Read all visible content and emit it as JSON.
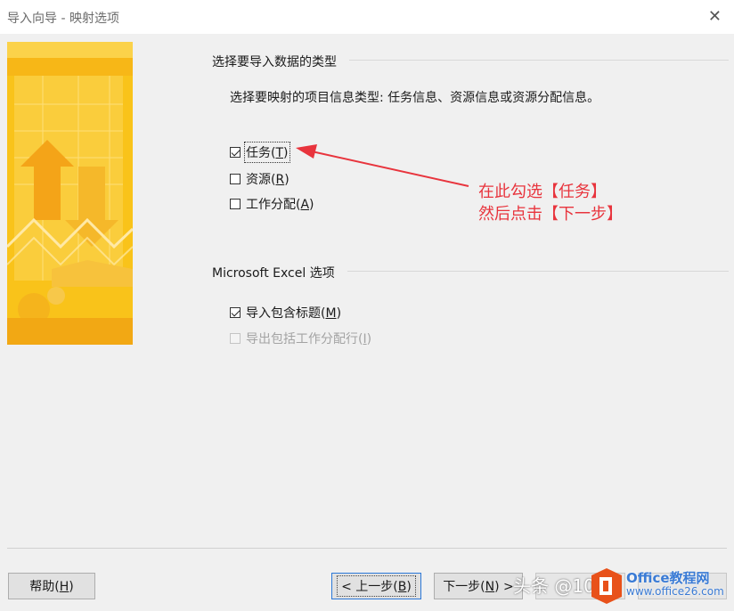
{
  "window": {
    "title": "导入向导 - 映射选项",
    "close_glyph": "✕"
  },
  "section_type": {
    "title": "选择要导入数据的类型",
    "description": "选择要映射的项目信息类型: 任务信息、资源信息或资源分配信息。",
    "options": [
      {
        "label": "任务(",
        "accel": "T",
        "suffix": ")",
        "checked": true
      },
      {
        "label": "资源(",
        "accel": "R",
        "suffix": ")",
        "checked": false
      },
      {
        "label": "工作分配(",
        "accel": "A",
        "suffix": ")",
        "checked": false
      }
    ]
  },
  "section_excel": {
    "title": "Microsoft Excel 选项",
    "options": [
      {
        "label": "导入包含标题(",
        "accel": "M",
        "suffix": ")",
        "checked": true,
        "enabled": true
      },
      {
        "label": "导出包括工作分配行(",
        "accel": "I",
        "suffix": ")",
        "checked": false,
        "enabled": false
      }
    ]
  },
  "annotation": {
    "line1": "在此勾选【任务】",
    "line2": "然后点击【下一步】",
    "color": "#e8343d"
  },
  "buttons": {
    "help": {
      "label": "帮助(",
      "accel": "H",
      "suffix": ")"
    },
    "back": {
      "label": "< 上一步(",
      "accel": "B",
      "suffix": ")"
    },
    "next": {
      "label": "下一步(",
      "accel": "N",
      "suffix": ") >"
    }
  },
  "watermark": {
    "left_text": "头条 @10",
    "brand": "Office教程网",
    "url": "www.office26.com"
  },
  "colors": {
    "accent": "#2b78d8",
    "banner": "#f9c31a"
  }
}
